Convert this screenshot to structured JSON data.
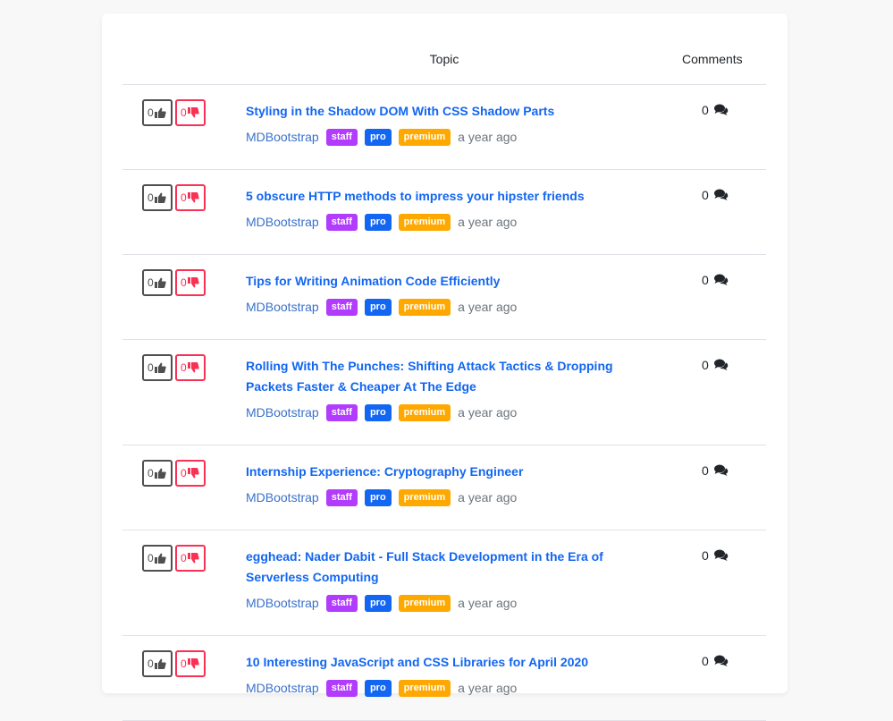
{
  "header": {
    "topic": "Topic",
    "comments": "Comments"
  },
  "rows": [
    {
      "likes": "0",
      "dislikes": "0",
      "title": "Styling in the Shadow DOM With CSS Shadow Parts",
      "author": "MDBootstrap",
      "badges": [
        "staff",
        "pro",
        "premium"
      ],
      "time": "a year ago",
      "comments": "0"
    },
    {
      "likes": "0",
      "dislikes": "0",
      "title": "5 obscure HTTP methods to impress your hipster friends",
      "author": "MDBootstrap",
      "badges": [
        "staff",
        "pro",
        "premium"
      ],
      "time": "a year ago",
      "comments": "0"
    },
    {
      "likes": "0",
      "dislikes": "0",
      "title": "Tips for Writing Animation Code Efficiently",
      "author": "MDBootstrap",
      "badges": [
        "staff",
        "pro",
        "premium"
      ],
      "time": "a year ago",
      "comments": "0"
    },
    {
      "likes": "0",
      "dislikes": "0",
      "title": "Rolling With The Punches: Shifting Attack Tactics & Dropping Packets Faster & Cheaper At The Edge",
      "author": "MDBootstrap",
      "badges": [
        "staff",
        "pro",
        "premium"
      ],
      "time": "a year ago",
      "comments": "0"
    },
    {
      "likes": "0",
      "dislikes": "0",
      "title": "Internship Experience: Cryptography Engineer",
      "author": "MDBootstrap",
      "badges": [
        "staff",
        "pro",
        "premium"
      ],
      "time": "a year ago",
      "comments": "0"
    },
    {
      "likes": "0",
      "dislikes": "0",
      "title": "egghead: Nader Dabit - Full Stack Development in the Era of Serverless Computing",
      "author": "MDBootstrap",
      "badges": [
        "staff",
        "pro",
        "premium"
      ],
      "time": "a year ago",
      "comments": "0"
    },
    {
      "likes": "0",
      "dislikes": "0",
      "title": "10 Interesting JavaScript and CSS Libraries for April 2020",
      "author": "MDBootstrap",
      "badges": [
        "staff",
        "pro",
        "premium"
      ],
      "time": "a year ago",
      "comments": "0"
    }
  ],
  "icons": {
    "like": "thumbs-up-icon",
    "dislike": "thumbs-down-icon",
    "comments": "comments-icon"
  },
  "colors": {
    "link": "#1266f1",
    "dislike": "#f93154",
    "staff": "#b23cfd",
    "pro": "#1266f1",
    "premium": "#ffa900"
  }
}
